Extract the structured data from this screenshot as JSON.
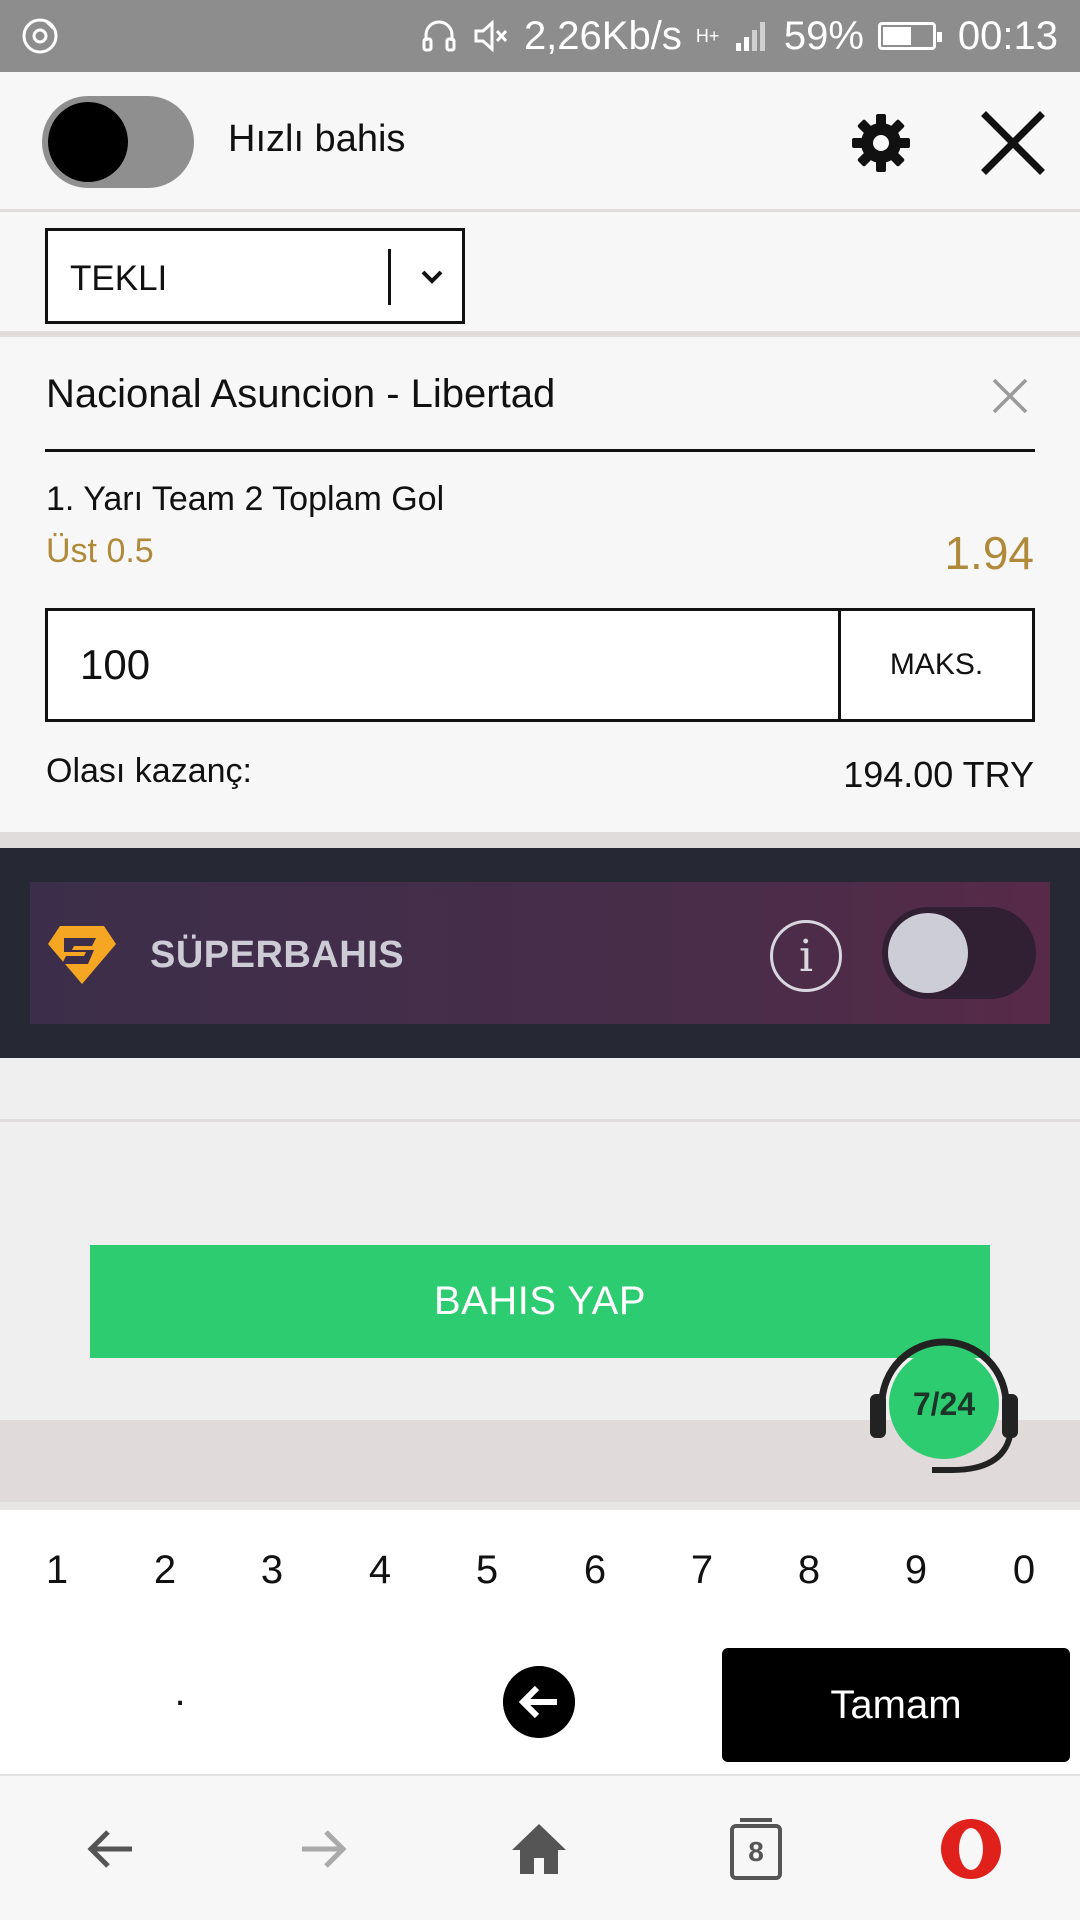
{
  "status_bar": {
    "speed": "2,26Kb/s",
    "network": "H+",
    "battery_percent": "59%",
    "battery_level": 0.59,
    "time": "00:13"
  },
  "header": {
    "quick_bet_label": "Hızlı bahis",
    "quick_bet_enabled": false
  },
  "bet_type": {
    "selected": "TEKLI"
  },
  "bet": {
    "match": "Nacional Asuncion - Libertad",
    "market": "1. Yarı Team 2 Toplam Gol",
    "selection": "Üst 0.5",
    "odds": "1.94",
    "stake": "100",
    "max_label": "MAKS.",
    "payout_label": "Olası kazanç:",
    "payout_value": "194.00 TRY"
  },
  "superbahis": {
    "label": "SÜPERBAHIS",
    "enabled": false
  },
  "place_bet_label": "BAHIS YAP",
  "support_badge": "7/24",
  "keypad": {
    "digits": [
      "1",
      "2",
      "3",
      "4",
      "5",
      "6",
      "7",
      "8",
      "9",
      "0"
    ],
    "dot": ".",
    "done": "Tamam"
  },
  "browser_nav": {
    "tab_count": "8"
  },
  "colors": {
    "accent_gold": "#b08a3a",
    "place_bet_green": "#2ecc71",
    "super_bg": "#262834"
  },
  "icons": [
    "media-icon",
    "headphones-icon",
    "mute-icon",
    "signal-icon",
    "battery-icon",
    "gear-icon",
    "close-icon",
    "chevron-down-icon",
    "remove-icon",
    "superbahis-logo-icon",
    "info-icon",
    "headset-icon",
    "backspace-icon",
    "back-arrow-icon",
    "forward-arrow-icon",
    "home-icon",
    "tabs-icon",
    "opera-icon"
  ]
}
